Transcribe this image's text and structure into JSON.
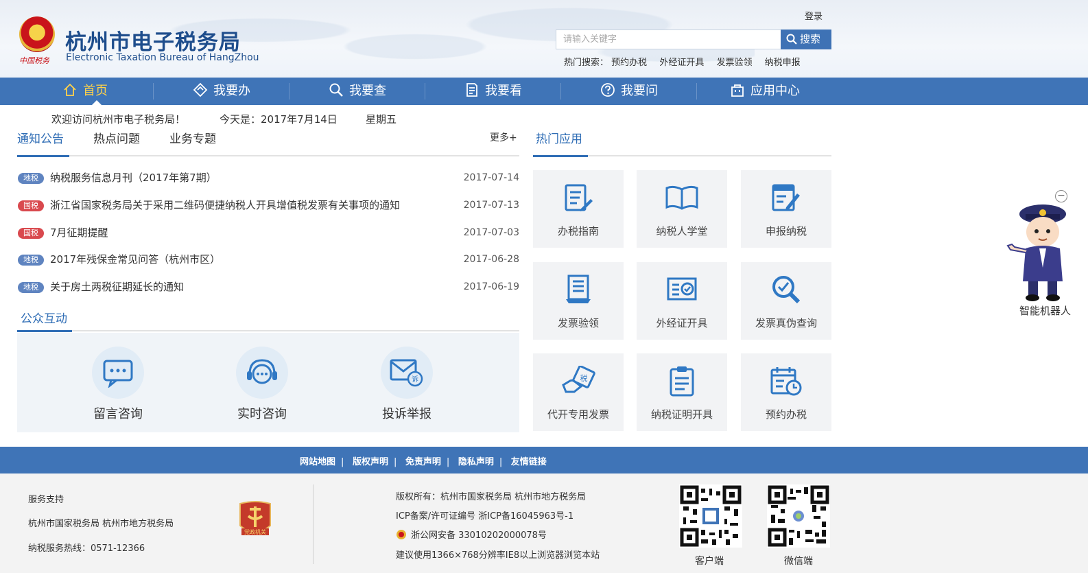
{
  "header": {
    "emblem_text": "中国税务",
    "title_cn": "杭州市电子税务局",
    "title_en": "Electronic Taxation Bureau of HangZhou",
    "login": "登录",
    "search_placeholder": "请输入关键字",
    "search_button": "搜索",
    "hot_label": "热门搜索：",
    "hot_links": [
      "预约办税",
      "外经证开具",
      "发票验领",
      "纳税申报"
    ]
  },
  "nav": {
    "items": [
      {
        "label": "首页",
        "icon": "home-icon"
      },
      {
        "label": "我要办",
        "icon": "diamond-icon"
      },
      {
        "label": "我要查",
        "icon": "search-icon"
      },
      {
        "label": "我要看",
        "icon": "document-icon"
      },
      {
        "label": "我要问",
        "icon": "question-icon"
      },
      {
        "label": "应用中心",
        "icon": "bag-icon"
      }
    ]
  },
  "welcome": {
    "greeting": "欢迎访问杭州市电子税务局！",
    "today": "今天是：2017年7月14日",
    "weekday": "星期五"
  },
  "notice": {
    "tabs": [
      "通知公告",
      "热点问题",
      "业务专题"
    ],
    "more": "更多+",
    "items": [
      {
        "badge": "地税",
        "type": "di",
        "title": "纳税服务信息月刊（2017年第7期）",
        "date": "2017-07-14"
      },
      {
        "badge": "国税",
        "type": "guo",
        "title": "浙江省国家税务局关于采用二维码便捷纳税人开具增值税发票有关事项的通知",
        "date": "2017-07-13"
      },
      {
        "badge": "国税",
        "type": "guo",
        "title": "7月征期提醒",
        "date": "2017-07-03"
      },
      {
        "badge": "地税",
        "type": "di",
        "title": "2017年残保金常见问答（杭州市区）",
        "date": "2017-06-28"
      },
      {
        "badge": "地税",
        "type": "di",
        "title": "关于房土两税征期延长的通知",
        "date": "2017-06-19"
      }
    ]
  },
  "public": {
    "title": "公众互动",
    "items": [
      {
        "label": "留言咨询",
        "icon": "chat-bubble-icon"
      },
      {
        "label": "实时咨询",
        "icon": "headset-chat-icon"
      },
      {
        "label": "投诉举报",
        "icon": "mail-complaint-icon",
        "icon_text": "诉"
      }
    ]
  },
  "apps": {
    "title": "热门应用",
    "items": [
      {
        "label": "办税指南",
        "icon": "guide-icon"
      },
      {
        "label": "纳税人学堂",
        "icon": "book-icon"
      },
      {
        "label": "申报纳税",
        "icon": "edit-form-icon"
      },
      {
        "label": "发票验领",
        "icon": "invoice-icon"
      },
      {
        "label": "外经证开具",
        "icon": "certificate-icon"
      },
      {
        "label": "发票真伪查询",
        "icon": "magnify-check-icon"
      },
      {
        "label": "代开专用发票",
        "icon": "hand-ticket-icon",
        "icon_text": "税"
      },
      {
        "label": "纳税证明开具",
        "icon": "clipboard-icon"
      },
      {
        "label": "预约办税",
        "icon": "calendar-clock-icon"
      }
    ]
  },
  "robot": {
    "label": "智能机器人",
    "close": "−"
  },
  "footer_links": [
    "网站地图",
    "版权声明",
    "免责声明",
    "隐私声明",
    "友情链接"
  ],
  "footer": {
    "support_title": "服务支持",
    "support_orgs": "杭州市国家税务局 杭州市地方税务局",
    "hotline": "纳税服务热线：0571-12366",
    "party_badge": "党政机关",
    "copyright": "版权所有：杭州市国家税务局    杭州市地方税务局",
    "icp": "ICP备案/许可证编号 浙ICP备16045963号-1",
    "police": "浙公网安备 33010202000078号",
    "recommend": "建议使用1366×768分辨率IE8以上浏览器浏览本站",
    "qr_client": "客户端",
    "qr_wechat": "微信端"
  },
  "colors": {
    "brand_blue": "#3f74b7",
    "link_blue": "#2f6db5",
    "guo_badge": "#d9494e",
    "di_badge": "#5f84c0",
    "nav_active": "#ffd24a"
  }
}
